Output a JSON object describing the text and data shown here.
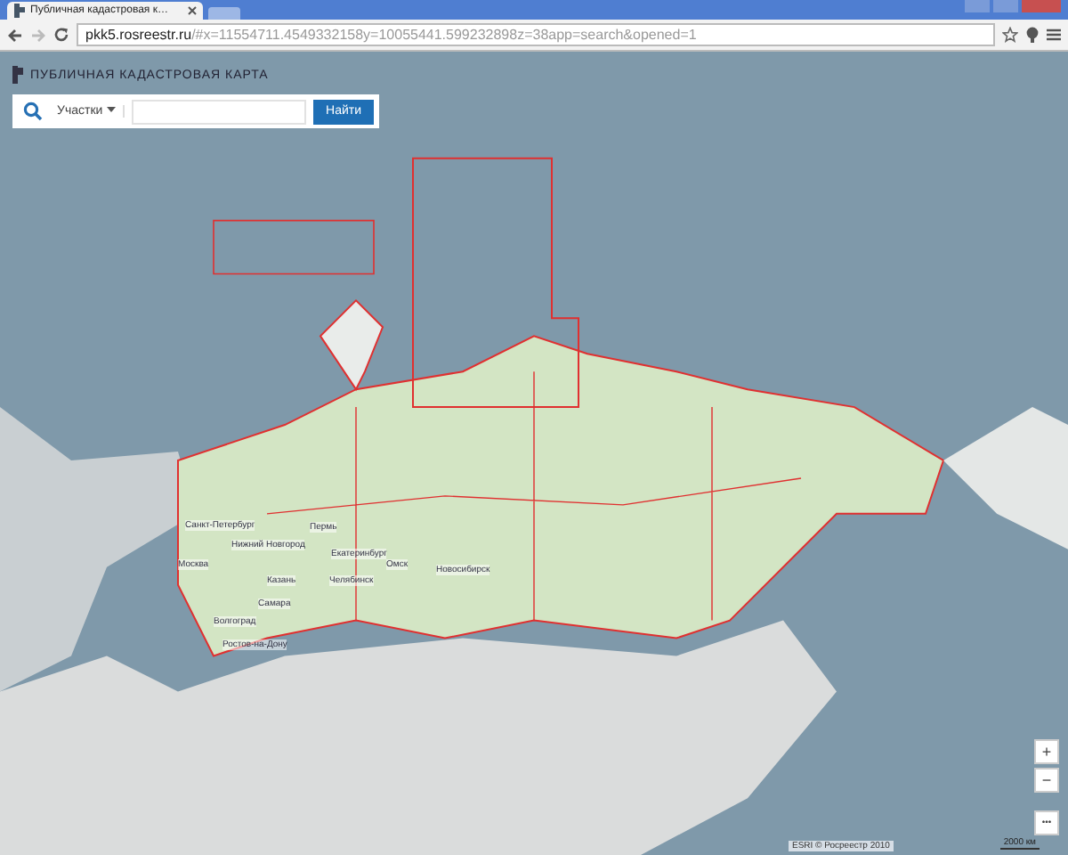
{
  "browser": {
    "tab_title": "Публичная кадастровая к…",
    "url_host": "pkk5.rosreestr.ru",
    "url_rest": "/#x=11554711.4549332158y=10055441.599232898z=38app=search&opened=1"
  },
  "app": {
    "title": "ПУБЛИЧНАЯ КАДАСТРОВАЯ КАРТА",
    "search": {
      "category": "Участки",
      "button": "Найти"
    }
  },
  "map": {
    "cities": [
      {
        "name": "Санкт-Петербург"
      },
      {
        "name": "Москва"
      },
      {
        "name": "Нижний Новгород"
      },
      {
        "name": "Казань"
      },
      {
        "name": "Самара"
      },
      {
        "name": "Пермь"
      },
      {
        "name": "Екатеринбург"
      },
      {
        "name": "Челябинск"
      },
      {
        "name": "Омск"
      },
      {
        "name": "Новосибирск"
      },
      {
        "name": "Волгоград"
      },
      {
        "name": "Ростов-на-Дону"
      }
    ],
    "controls": {
      "zoom_in": "+",
      "zoom_out": "−",
      "more": "•••"
    },
    "scale": "2000 км",
    "attribution": "ESRI © Росреестр 2010"
  }
}
